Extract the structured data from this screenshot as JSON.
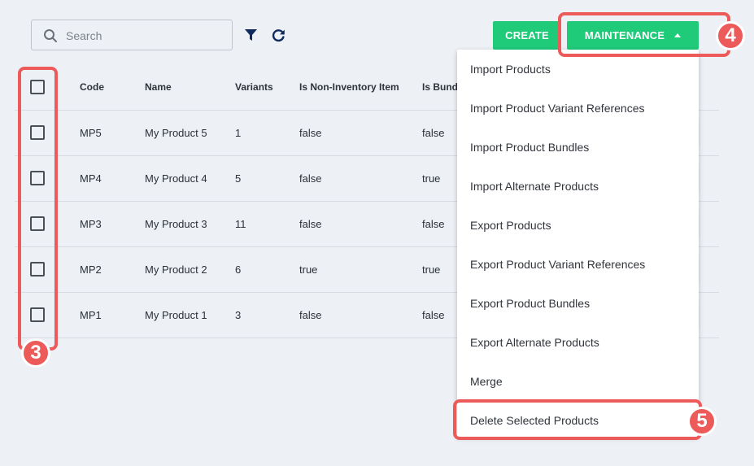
{
  "toolbar": {
    "search_placeholder": "Search",
    "create_label": "CREATE",
    "maintenance_label": "MAINTENANCE"
  },
  "table": {
    "headers": {
      "code": "Code",
      "name": "Name",
      "variants": "Variants",
      "non_inventory": "Is Non-Inventory Item",
      "bundle": "Is Bundle"
    },
    "rows": [
      {
        "code": "MP5",
        "name": "My Product 5",
        "variants": "1",
        "non_inventory": "false",
        "bundle": "false"
      },
      {
        "code": "MP4",
        "name": "My Product 4",
        "variants": "5",
        "non_inventory": "false",
        "bundle": "true"
      },
      {
        "code": "MP3",
        "name": "My Product 3",
        "variants": "11",
        "non_inventory": "false",
        "bundle": "false"
      },
      {
        "code": "MP2",
        "name": "My Product 2",
        "variants": "6",
        "non_inventory": "true",
        "bundle": "true"
      },
      {
        "code": "MP1",
        "name": "My Product 1",
        "variants": "3",
        "non_inventory": "false",
        "bundle": "false"
      }
    ]
  },
  "menu": {
    "items": [
      "Import Products",
      "Import Product Variant References",
      "Import Product Bundles",
      "Import Alternate Products",
      "Export Products",
      "Export Product Variant References",
      "Export Product Bundles",
      "Export Alternate Products",
      "Merge",
      "Delete Selected Products"
    ]
  },
  "annotations": {
    "step_3": "3",
    "step_4": "4",
    "step_5": "5"
  },
  "colors": {
    "accent_green": "#1fca79",
    "highlight_red": "#ec5a5a",
    "filter_icon": "#0f2a5c"
  },
  "icons": [
    "search-icon",
    "filter-icon",
    "refresh-icon",
    "caret-up-icon"
  ]
}
